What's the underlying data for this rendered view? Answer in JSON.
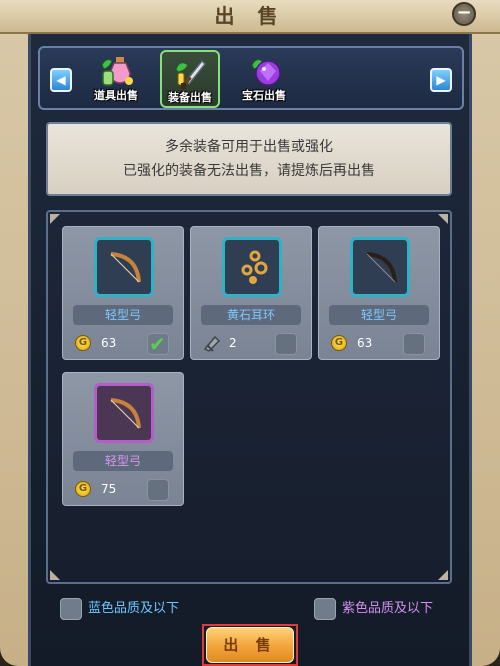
{
  "window": {
    "title": "出 售"
  },
  "tabs": [
    {
      "label": "道具出售",
      "icon": "potion-icon"
    },
    {
      "label": "装备出售",
      "icon": "sword-icon",
      "active": true
    },
    {
      "label": "宝石出售",
      "icon": "gem-icon"
    }
  ],
  "notice": {
    "line1": "多余装备可用于出售或强化",
    "line2": "已强化的装备无法出售，请提炼后再出售"
  },
  "items": [
    {
      "name": "轻型弓",
      "price": "63",
      "currency": "coin-icon",
      "quality": "blue",
      "checked": true
    },
    {
      "name": "黄石耳环",
      "price": "2",
      "currency": "material-icon",
      "quality": "blue",
      "checked": false
    },
    {
      "name": "轻型弓",
      "price": "63",
      "currency": "coin-icon",
      "quality": "blue",
      "checked": false
    },
    {
      "name": "轻型弓",
      "price": "75",
      "currency": "coin-icon",
      "quality": "purple",
      "checked": false
    }
  ],
  "filters": {
    "blue_label": "蓝色品质及以下",
    "purple_label": "紫色品质及以下"
  },
  "sell_button": {
    "label": "出 售"
  },
  "colors": {
    "blue_quality": "#2eb3c6",
    "purple_quality": "#b45cc8",
    "sell_button": "#f2a33a"
  }
}
